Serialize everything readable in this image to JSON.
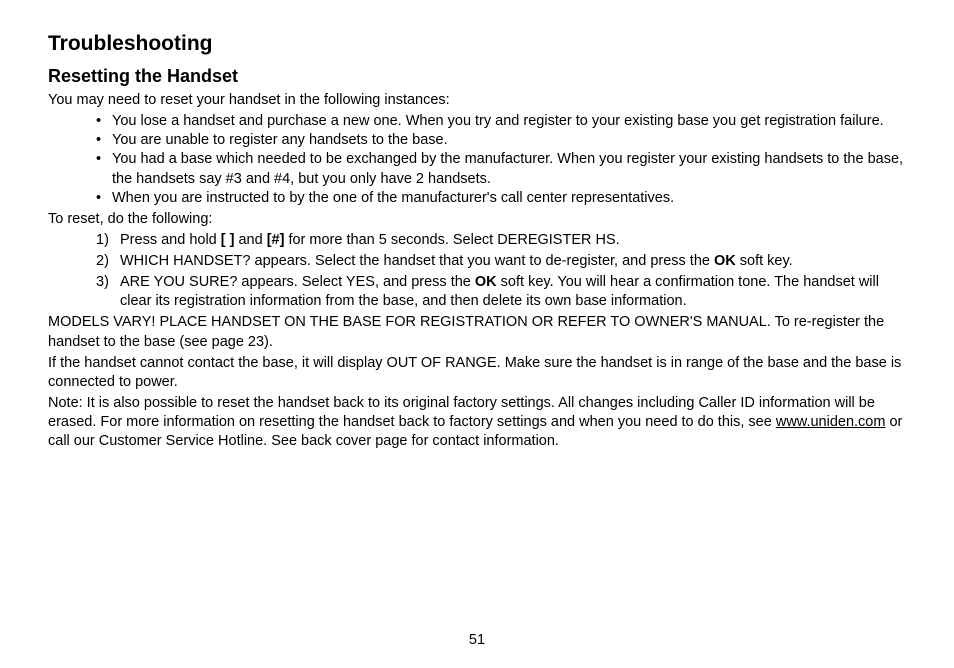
{
  "title": "Troubleshooting",
  "subtitle": "Resetting the Handset",
  "intro": "You may need to reset your handset in the following instances:",
  "bullets": [
    "You lose a handset and purchase a new one. When you try and register to your existing base you get registration failure.",
    "You are unable to register any handsets to the base.",
    "You had a base which needed to be exchanged by the manufacturer. When you register your existing handsets to the base, the handsets say #3 and #4, but you only have 2 handsets.",
    "When you are instructed to by the one of the manufacturer's call center representatives."
  ],
  "resetIntro": "To reset, do the following:",
  "steps": {
    "s1": {
      "num": "1)",
      "pre": "Press and hold ",
      "key1": "[ ]",
      "mid": " and ",
      "key2": "[#]",
      "post": " for more than 5 seconds. Select DEREGISTER HS."
    },
    "s2": {
      "num": "2)",
      "pre": "WHICH HANDSET? appears. Select the handset that you want to de-register, and press the ",
      "ok": "OK",
      "post": " soft key."
    },
    "s3": {
      "num": "3)",
      "pre": "ARE YOU SURE? appears. Select YES, and press the ",
      "ok": "OK",
      "post": " soft key. You will hear a confirmation tone. The handset will clear its registration information from the base, and then delete its own base information."
    }
  },
  "models": "MODELS VARY! PLACE HANDSET ON THE BASE FOR REGISTRATION OR REFER TO OWNER'S MANUAL. To re-register the handset to the base (see page 23).",
  "outOfRange": "If the handset cannot contact the base, it will display OUT OF RANGE. Make sure the handset is in range of the base and the base is connected to power.",
  "note": {
    "pre": "Note: It is also possible to reset the handset back to its original factory settings. All changes including Caller ID information will be erased. For more information on resetting the handset back to factory settings and when you need to do this, see ",
    "link": "www.uniden.com",
    "post": " or call our Customer Service Hotline. See back cover page for contact information."
  },
  "pageNumber": "51"
}
